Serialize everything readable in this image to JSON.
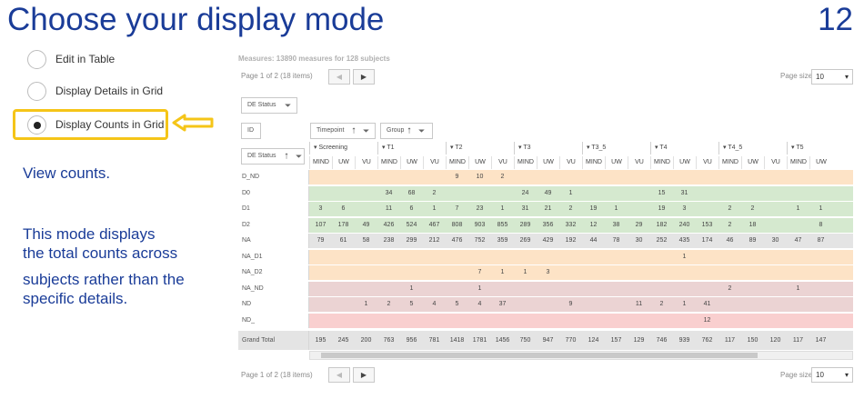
{
  "slide": {
    "title": "Choose your display mode",
    "number": "12"
  },
  "modes": [
    {
      "label": "Edit in Table",
      "selected": false
    },
    {
      "label": "Display Details in Grid",
      "selected": false
    },
    {
      "label": "Display Counts in Grid",
      "selected": true
    }
  ],
  "notes": {
    "heading": "View counts.",
    "lines": [
      "This mode displays",
      "the total counts across",
      "subjects rather than the",
      "specific details."
    ]
  },
  "grid": {
    "measures": "Measures: 13890 measures for 128 subjects",
    "page_info": "Page 1 of 2 (18 items)",
    "page_size_label": "Page size:",
    "page_size_value": "10",
    "prev_icon": "◀",
    "next_icon": "▶",
    "filter_chips": {
      "de_status": "DE Status",
      "id": "ID",
      "timepoint": "Timepoint",
      "group": "Group"
    },
    "row_header": "DE Status",
    "columns": [
      {
        "group": "Screening",
        "subs": [
          "MIND",
          "UW",
          "VU"
        ]
      },
      {
        "group": "T1",
        "subs": [
          "MIND",
          "UW",
          "VU"
        ]
      },
      {
        "group": "T2",
        "subs": [
          "MIND",
          "UW",
          "VU"
        ]
      },
      {
        "group": "T3",
        "subs": [
          "MIND",
          "UW",
          "VU"
        ]
      },
      {
        "group": "T3_5",
        "subs": [
          "MIND",
          "UW",
          "VU"
        ]
      },
      {
        "group": "T4",
        "subs": [
          "MIND",
          "UW",
          "VU"
        ]
      },
      {
        "group": "T4_5",
        "subs": [
          "MIND",
          "UW",
          "VU"
        ]
      },
      {
        "group": "T5",
        "subs": [
          "MIND",
          "UW"
        ]
      }
    ],
    "rows": [
      {
        "label": "D_ND",
        "color": "#fde3c6",
        "cells": [
          "",
          "",
          "",
          "",
          "",
          "",
          "9",
          "10",
          "2",
          "",
          "",
          "",
          "",
          "",
          "",
          "",
          "",
          "",
          "",
          "",
          "",
          "",
          ""
        ]
      },
      {
        "label": "D0",
        "color": "#d5e9cf",
        "cells": [
          "",
          "",
          "",
          "34",
          "68",
          "2",
          "",
          "",
          "",
          "24",
          "49",
          "1",
          "",
          "",
          "",
          "15",
          "31",
          "",
          "",
          "",
          "",
          "",
          ""
        ]
      },
      {
        "label": "D1",
        "color": "#d5e9cf",
        "cells": [
          "3",
          "6",
          "",
          "11",
          "6",
          "1",
          "7",
          "23",
          "1",
          "31",
          "21",
          "2",
          "19",
          "1",
          "",
          "19",
          "3",
          "",
          "2",
          "2",
          "",
          "1",
          "1"
        ]
      },
      {
        "label": "D2",
        "color": "#d5e9cf",
        "cells": [
          "107",
          "178",
          "49",
          "426",
          "524",
          "467",
          "808",
          "903",
          "855",
          "289",
          "356",
          "332",
          "12",
          "38",
          "29",
          "182",
          "240",
          "153",
          "2",
          "18",
          "",
          "",
          "8"
        ]
      },
      {
        "label": "NA",
        "color": "#e4e4e4",
        "cells": [
          "79",
          "61",
          "58",
          "238",
          "299",
          "212",
          "476",
          "752",
          "359",
          "269",
          "429",
          "192",
          "44",
          "78",
          "30",
          "252",
          "435",
          "174",
          "46",
          "89",
          "30",
          "47",
          "87"
        ]
      },
      {
        "label": "NA_D1",
        "color": "#fde3c6",
        "cells": [
          "",
          "",
          "",
          "",
          "",
          "",
          "",
          "",
          "",
          "",
          "",
          "",
          "",
          "",
          "",
          "",
          "1",
          "",
          "",
          "",
          "",
          "",
          ""
        ]
      },
      {
        "label": "NA_D2",
        "color": "#fde3c6",
        "cells": [
          "",
          "",
          "",
          "",
          "",
          "",
          "",
          "7",
          "1",
          "1",
          "3",
          "",
          "",
          "",
          "",
          "",
          "",
          "",
          "",
          "",
          "",
          "",
          ""
        ]
      },
      {
        "label": "NA_ND",
        "color": "#ebd3d3",
        "cells": [
          "",
          "",
          "",
          "",
          "1",
          "",
          "",
          "1",
          "",
          "",
          "",
          "",
          "",
          "",
          "",
          "",
          "",
          "",
          "2",
          "",
          "",
          "1",
          ""
        ]
      },
      {
        "label": "ND",
        "color": "#ebd3d3",
        "cells": [
          "",
          "",
          "1",
          "2",
          "5",
          "4",
          "5",
          "4",
          "37",
          "",
          "",
          "9",
          "",
          "",
          "11",
          "2",
          "1",
          "41",
          "",
          "",
          "",
          "",
          ""
        ]
      },
      {
        "label": "ND_",
        "color": "#f9cfcf",
        "cells": [
          "",
          "",
          "",
          "",
          "",
          "",
          "",
          "",
          "",
          "",
          "",
          "",
          "",
          "",
          "",
          "",
          "",
          "12",
          "",
          "",
          "",
          "",
          ""
        ]
      },
      {
        "label": "Grand Total",
        "color": "#e4e4e4",
        "cells": [
          "195",
          "245",
          "200",
          "763",
          "956",
          "781",
          "1418",
          "1781",
          "1456",
          "750",
          "947",
          "770",
          "124",
          "157",
          "129",
          "746",
          "939",
          "762",
          "117",
          "150",
          "120",
          "117",
          "147"
        ]
      }
    ]
  }
}
